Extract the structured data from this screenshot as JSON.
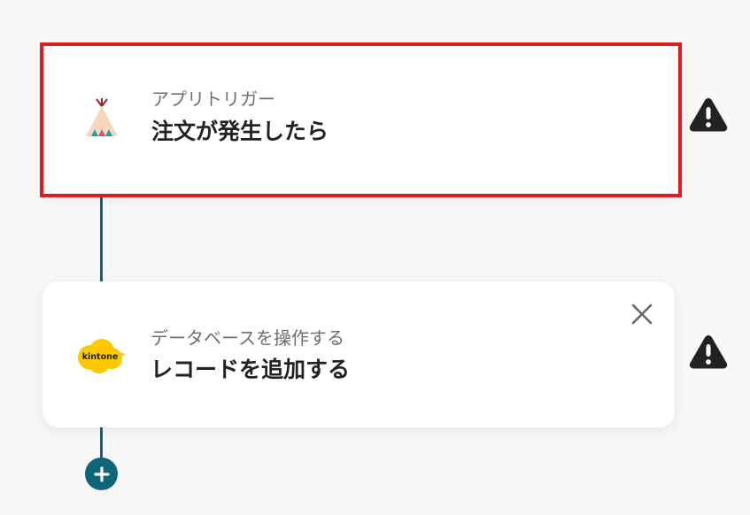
{
  "flow": {
    "steps": [
      {
        "subtitle": "アプリトリガー",
        "title": "注文が発生したら",
        "icon": "teepee-app-icon",
        "selected": true,
        "warning_icon": "warning-triangle-icon"
      },
      {
        "subtitle": "データベースを操作する",
        "title": "レコードを追加する",
        "icon": "kintone-icon",
        "icon_text": "kintone",
        "close_icon": "close-icon",
        "warning_icon": "warning-triangle-icon"
      }
    ],
    "add_button_icon": "plus-icon"
  },
  "colors": {
    "accent": "#0f6577",
    "selection_border": "#e11c1f",
    "kintone_yellow": "#fcc800",
    "warning": "#222222"
  }
}
